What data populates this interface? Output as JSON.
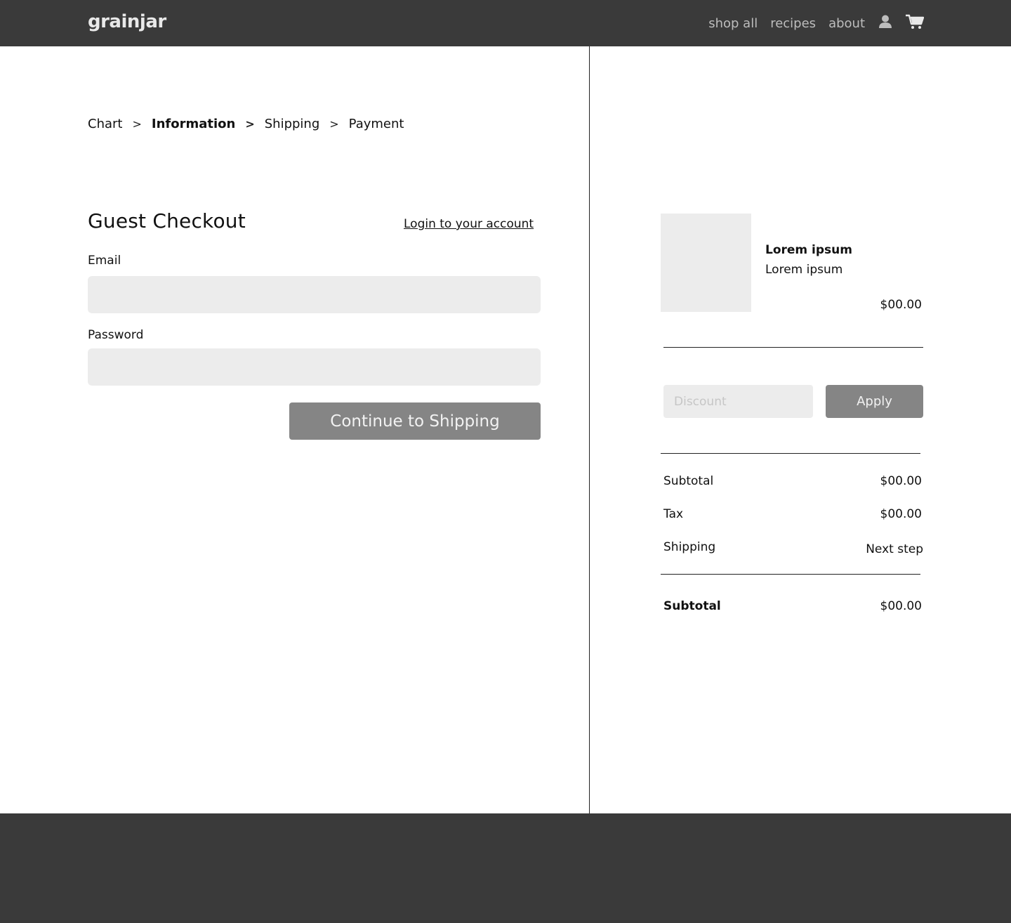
{
  "header": {
    "logo": "grainjar",
    "nav": [
      "shop all",
      "recipes",
      "about"
    ],
    "icons": [
      "user-icon",
      "cart-icon"
    ]
  },
  "breadcrumb": {
    "items": [
      "Chart",
      "Information",
      "Shipping",
      "Payment"
    ],
    "active": "Information",
    "separator": ">"
  },
  "form": {
    "title": "Guest Checkout",
    "login_link": "Login to your account",
    "email_label": "Email",
    "email_value": "",
    "password_label": "Password",
    "password_value": "",
    "submit_label": "Continue to Shipping"
  },
  "cart": {
    "item": {
      "name": "Lorem ipsum",
      "variant": "Lorem ipsum",
      "price": "$00.00"
    },
    "discount_placeholder": "Discount",
    "apply_label": "Apply",
    "summary": [
      {
        "label": "Subtotal",
        "value": "$00.00"
      },
      {
        "label": "Tax",
        "value": "$00.00"
      },
      {
        "label": "Shipping",
        "value": "Next step"
      }
    ],
    "total": {
      "label": "Subtotal",
      "value": "$00.00"
    }
  },
  "colors": {
    "header_bg": "#3a3a3a",
    "button_bg": "#858585",
    "input_bg": "#ececec"
  }
}
